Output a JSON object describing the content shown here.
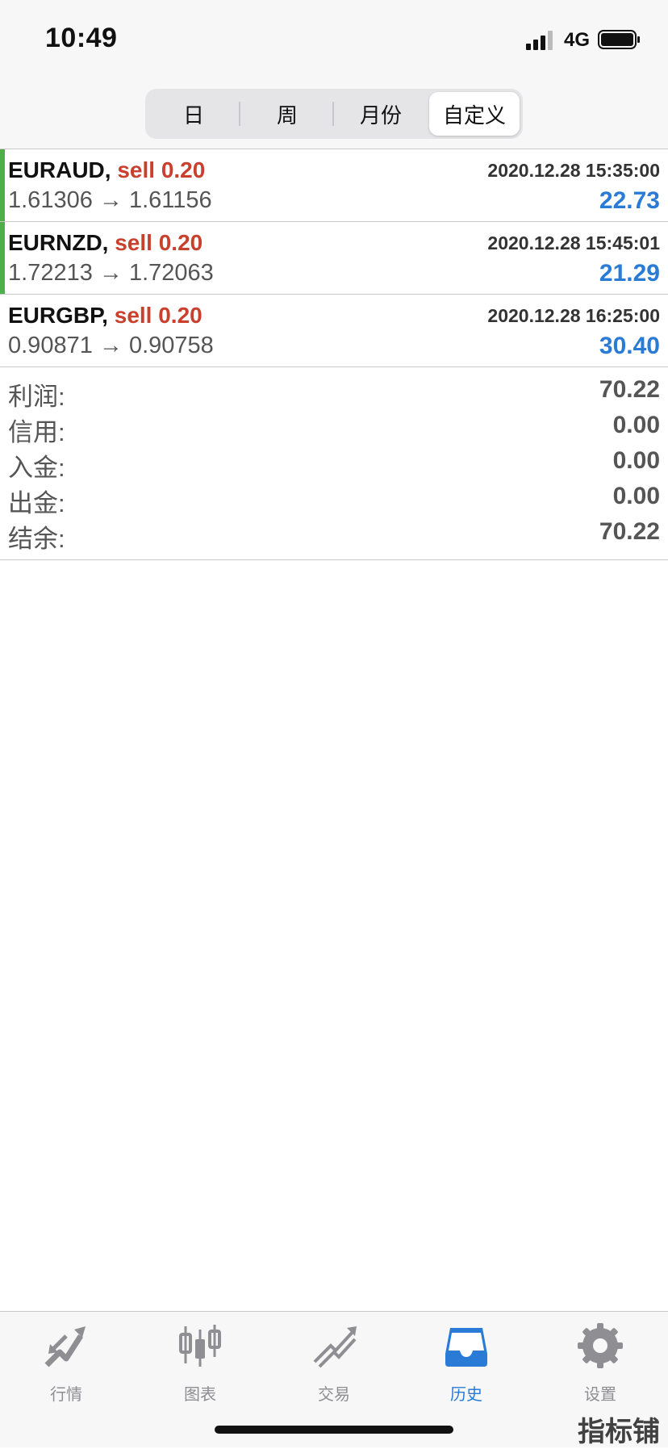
{
  "status_bar": {
    "time": "10:49",
    "network": "4G"
  },
  "period_tabs": [
    {
      "label": "日",
      "selected": false
    },
    {
      "label": "周",
      "selected": false
    },
    {
      "label": "月份",
      "selected": false
    },
    {
      "label": "自定义",
      "selected": true
    }
  ],
  "deals": [
    {
      "symbol": "EURAUD,",
      "action": "sell 0.20",
      "time": "2020.12.28 15:35:00",
      "prices": "1.61306 → 1.61156",
      "profit": "22.73",
      "marker": true
    },
    {
      "symbol": "EURNZD,",
      "action": "sell 0.20",
      "time": "2020.12.28 15:45:01",
      "prices": "1.72213 → 1.72063",
      "profit": "21.29",
      "marker": true
    },
    {
      "symbol": "EURGBP,",
      "action": "sell 0.20",
      "time": "2020.12.28 16:25:00",
      "prices": "0.90871 → 0.90758",
      "profit": "30.40",
      "marker": false
    }
  ],
  "summary": [
    {
      "label": "利润:",
      "value": "70.22"
    },
    {
      "label": "信用:",
      "value": "0.00"
    },
    {
      "label": "入金:",
      "value": "0.00"
    },
    {
      "label": "出金:",
      "value": "0.00"
    },
    {
      "label": "结余:",
      "value": "70.22"
    }
  ],
  "tab_bar": [
    {
      "label": "行情",
      "icon": "quotes-icon",
      "active": false
    },
    {
      "label": "图表",
      "icon": "chart-icon",
      "active": false
    },
    {
      "label": "交易",
      "icon": "trade-icon",
      "active": false
    },
    {
      "label": "历史",
      "icon": "history-icon",
      "active": true
    },
    {
      "label": "设置",
      "icon": "settings-icon",
      "active": false
    }
  ],
  "watermark": "指标铺",
  "colors": {
    "sell": "#c9402e",
    "profit": "#2a7bd5",
    "marker": "#4cae4c",
    "tab_active": "#2a7bd5",
    "tab_inactive": "#8e8e93"
  }
}
